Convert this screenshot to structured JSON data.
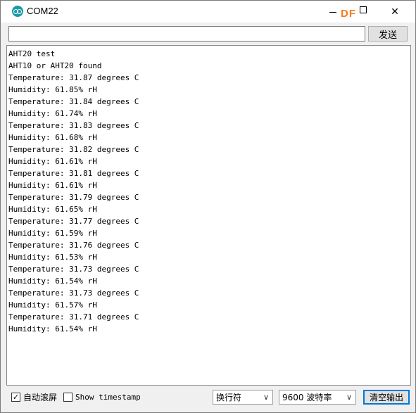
{
  "window": {
    "title": "COM22"
  },
  "watermark": "DF",
  "send": {
    "input_value": "",
    "button_label": "发送"
  },
  "output": {
    "lines": [
      "AHT20 test",
      "AHT10 or AHT20 found",
      "Temperature: 31.87 degrees C",
      "Humidity: 61.85% rH",
      "Temperature: 31.84 degrees C",
      "Humidity: 61.74% rH",
      "Temperature: 31.83 degrees C",
      "Humidity: 61.68% rH",
      "Temperature: 31.82 degrees C",
      "Humidity: 61.61% rH",
      "Temperature: 31.81 degrees C",
      "Humidity: 61.61% rH",
      "Temperature: 31.79 degrees C",
      "Humidity: 61.65% rH",
      "Temperature: 31.77 degrees C",
      "Humidity: 61.59% rH",
      "Temperature: 31.76 degrees C",
      "Humidity: 61.53% rH",
      "Temperature: 31.73 degrees C",
      "Humidity: 61.54% rH",
      "Temperature: 31.73 degrees C",
      "Humidity: 61.57% rH",
      "Temperature: 31.71 degrees C",
      "Humidity: 61.54% rH"
    ]
  },
  "bottom": {
    "autoscroll": {
      "label": "自动滚屏",
      "checked": true
    },
    "timestamp": {
      "label": "Show timestamp",
      "checked": false
    },
    "line_ending": "换行符",
    "baud_rate": "9600 波特率",
    "clear_label": "清空输出"
  },
  "colors": {
    "accent": "#0078d7",
    "app_icon": "#1b9aa6",
    "watermark": "#f47b20"
  }
}
